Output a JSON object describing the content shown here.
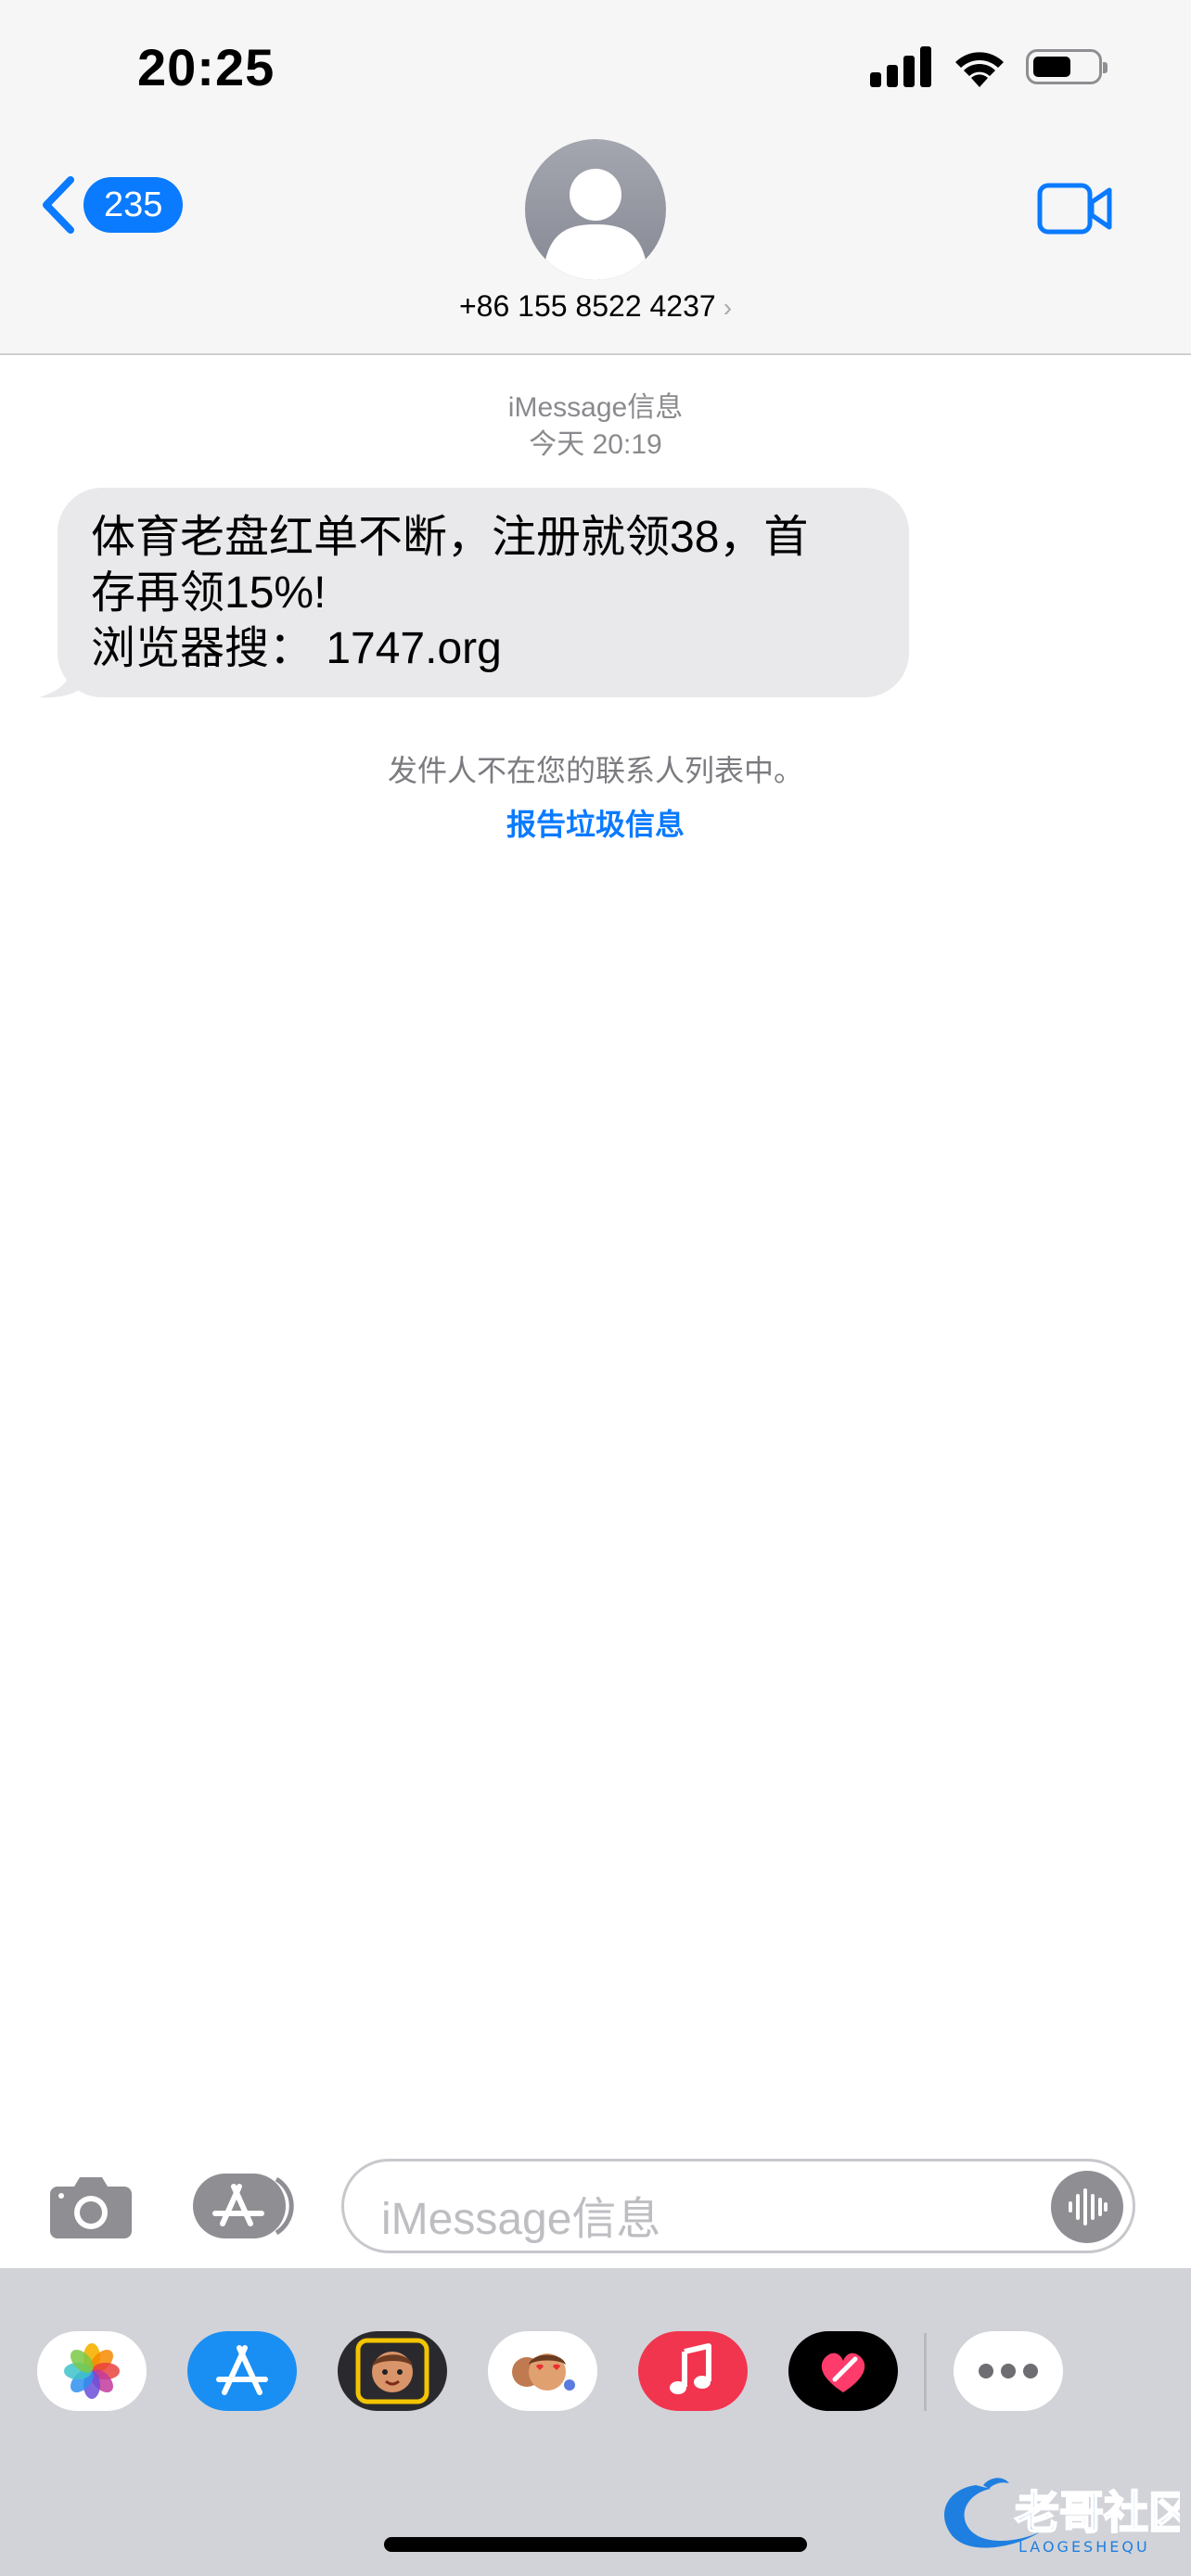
{
  "status": {
    "time": "20:25"
  },
  "header": {
    "unread_count": "235",
    "contact_number": "+86 155 8522 4237",
    "chevron": "›"
  },
  "conversation": {
    "service": "iMessage信息",
    "timestamp": "今天 20:19",
    "message": {
      "line1": "体育老盘红单不断，注册就领38，首",
      "line2": "存再领15%!",
      "line3": "浏览器搜： 1747.org"
    },
    "notice": "发件人不在您的联系人列表中。",
    "report_link": "报告垃圾信息"
  },
  "input": {
    "placeholder": "iMessage信息"
  },
  "drawer": {
    "apps": [
      "photos-icon",
      "app-store-icon",
      "memoji-icon",
      "animoji-stickers-icon",
      "music-icon",
      "digital-touch-icon",
      "more-icon"
    ]
  },
  "watermark": {
    "text": "老哥社区",
    "subtext": "LAOGESHEQU"
  },
  "colors": {
    "accent": "#0a7aff",
    "bubble": "#e9e9eb",
    "drawer": "#d2d3d8"
  }
}
